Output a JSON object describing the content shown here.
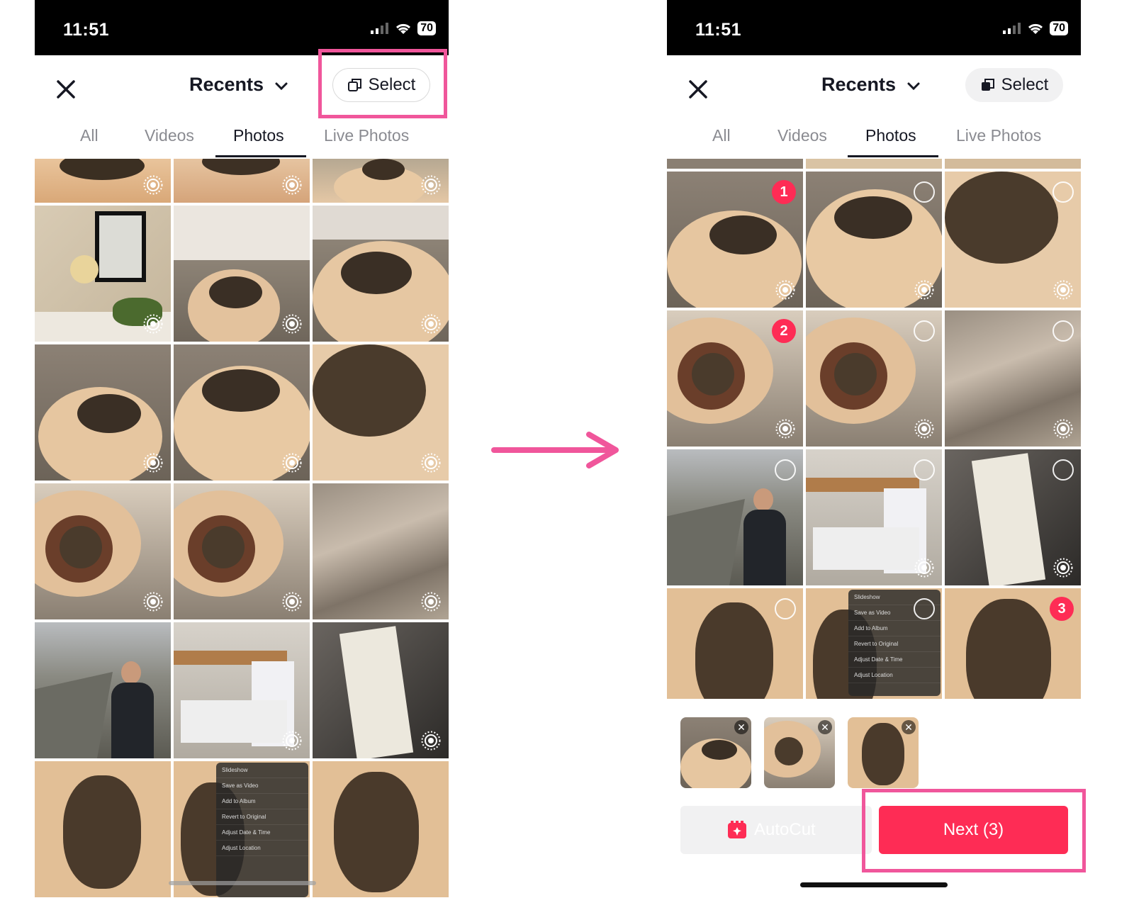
{
  "left_screen": {
    "status": {
      "time": "11:51",
      "battery": "70"
    },
    "header": {
      "album_title": "Recents",
      "select_label": "Select"
    },
    "tabs": [
      "All",
      "Videos",
      "Photos",
      "Live Photos"
    ],
    "active_tab": "Photos",
    "menu_items": [
      "Slideshow",
      "Save as Video",
      "Add to Album",
      "Revert to Original",
      "Adjust Date & Time",
      "Adjust Location"
    ]
  },
  "right_screen": {
    "status": {
      "time": "11:51",
      "battery": "70"
    },
    "header": {
      "album_title": "Recents",
      "select_label": "Select"
    },
    "tabs": [
      "All",
      "Videos",
      "Photos",
      "Live Photos"
    ],
    "active_tab": "Photos",
    "selection_numbers": [
      "1",
      "2",
      "3"
    ],
    "menu_items": [
      "Slideshow",
      "Save as Video",
      "Add to Album",
      "Revert to Original",
      "Adjust Date & Time",
      "Adjust Location"
    ],
    "autocut_label": "AutoCut",
    "next_label": "Next (3)"
  },
  "colors": {
    "accent": "#fe2c55",
    "highlight": "#f0569b",
    "arrow": "#f0569b"
  }
}
